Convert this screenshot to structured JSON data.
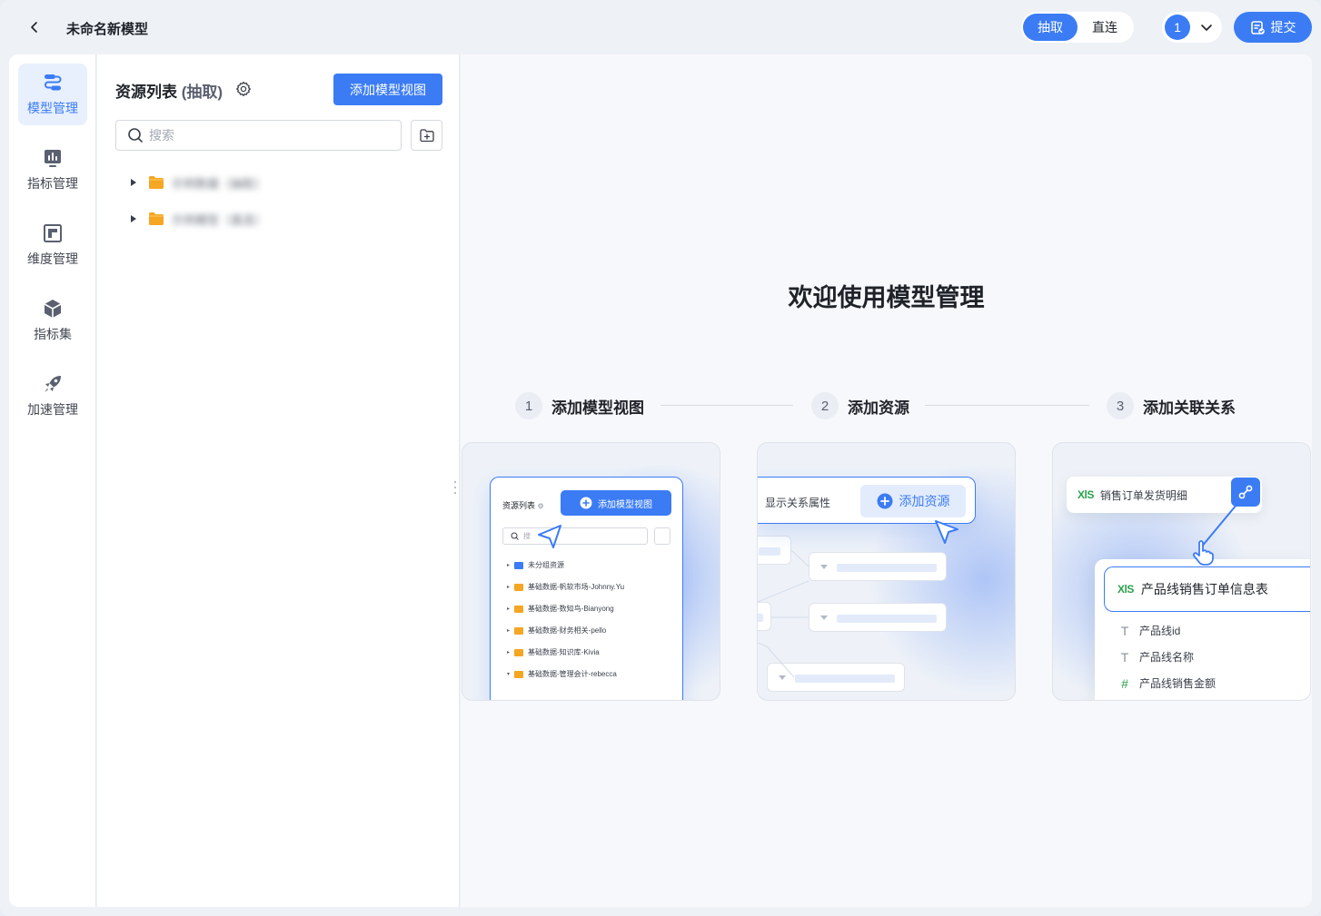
{
  "header": {
    "title": "未命名新模型",
    "mode_options": [
      "抽取",
      "直连"
    ],
    "mode_active": "抽取",
    "version": "1",
    "submit_label": "提交"
  },
  "sidebar": {
    "items": [
      {
        "label": "模型管理",
        "icon": "model-manage-icon",
        "active": true
      },
      {
        "label": "指标管理",
        "icon": "metric-chart-icon",
        "active": false
      },
      {
        "label": "维度管理",
        "icon": "dimension-icon",
        "active": false
      },
      {
        "label": "指标集",
        "icon": "cube-icon",
        "active": false
      },
      {
        "label": "加速管理",
        "icon": "rocket-icon",
        "active": false
      }
    ]
  },
  "resource_panel": {
    "title": "资源列表",
    "title_mode": "(抽取)",
    "add_view_label": "添加模型视图",
    "search_placeholder": "搜索",
    "tree": [
      {
        "label": "示例数据（抽取）"
      },
      {
        "label": "示例模型（直连）"
      }
    ]
  },
  "main": {
    "welcome": "欢迎使用模型管理",
    "steps": [
      {
        "num": "1",
        "label": "添加模型视图"
      },
      {
        "num": "2",
        "label": "添加资源"
      },
      {
        "num": "3",
        "label": "添加关联关系"
      }
    ],
    "card1": {
      "title": "资源列表",
      "button": "添加模型视图",
      "search": "搜",
      "rows": [
        "未分组资源",
        "基础数据-帆软市场-Johnny.Yu",
        "基础数据-数知鸟-Bianyong",
        "基础数据-财务相关-pello",
        "基础数据-知识库-Kivia",
        "基础数据-管理会计-rebecca"
      ]
    },
    "card2": {
      "label": "显示关系属性",
      "button": "添加资源"
    },
    "card3": {
      "xls": "XlS",
      "source": "销售订单发货明细",
      "target": "产品线销售订单信息表",
      "fields": [
        {
          "type": "T",
          "name": "产品线id"
        },
        {
          "type": "T",
          "name": "产品线名称"
        },
        {
          "type": "#",
          "name": "产品线销售金额"
        }
      ]
    }
  },
  "colors": {
    "accent": "#3b7cf5",
    "folder": "#f5a623",
    "xls": "#2ba24c"
  }
}
